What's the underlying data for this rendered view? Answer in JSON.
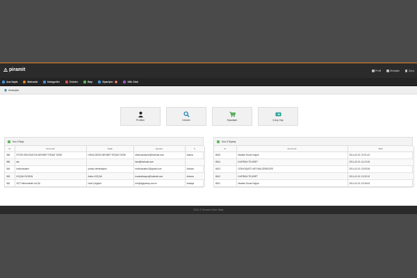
{
  "header": {
    "logo_text": "piramit",
    "right": [
      {
        "label": "Profil",
        "icon": "user-icon"
      },
      {
        "label": "Mesajlar",
        "icon": "mail-icon"
      },
      {
        "label": "Çıkış",
        "icon": "logout-icon"
      }
    ]
  },
  "nav": [
    {
      "label": "Ana Sayfa",
      "icon": "home-icon",
      "color": "#4a90d9"
    },
    {
      "label": "Mahsulat",
      "icon": "orange-icon",
      "color": "#e8892c"
    },
    {
      "label": "Kategoriler",
      "icon": "grid-icon",
      "color": "#4a90d9"
    },
    {
      "label": "Ürünler",
      "icon": "box-icon",
      "color": "#d9534f"
    },
    {
      "label": "Bayi",
      "icon": "dealer-icon",
      "color": "#5cb85c"
    },
    {
      "label": "Siparişler",
      "icon": "cart-icon",
      "color": "#4a90d9",
      "badge": "5"
    },
    {
      "label": "XML Stok",
      "icon": "xml-icon",
      "color": "#9b59b6"
    }
  ],
  "breadcrumb": "Anasayfa",
  "tiles": [
    {
      "label": "Profilim",
      "icon": "user-icon"
    },
    {
      "label": "Ürünler",
      "icon": "search-icon"
    },
    {
      "label": "Siparişler",
      "icon": "cart-icon"
    },
    {
      "label": "Çıkış Yap",
      "icon": "exit-icon"
    }
  ],
  "left_panel": {
    "title": "Son 5 Bayi",
    "columns": [
      "Id",
      "Firma Adı",
      "Yetkili",
      "Eposta",
      "İl"
    ],
    "rows": [
      [
        "366",
        "ETKİN SOKOKAYON MEHMET REŞAT DEDE",
        "HİKKA DEDE MEHMET REŞAT DEDE",
        "etkinsokoksnet@hotmail.com",
        "Adana"
      ],
      [
        "365",
        "afs",
        "",
        "fasd@hotmail.com",
        ""
      ],
      [
        "364",
        "mafa tasarim",
        "yılmaz demirkaşımı",
        "mafa.tasarim2@gmail.com",
        "Ankara"
      ],
      [
        "363",
        "KOÇAK EKSKIN",
        "Adem KOÇAK",
        "kocakeksayın@hotmail.com",
        "Ankara"
      ],
      [
        "362",
        "SGT Mühendislik Ltd.Şti",
        "İzzet Çelgünü",
        "info@sgtpiresp.com.tr",
        "Antalya"
      ]
    ]
  },
  "right_panel": {
    "title": "Son 5 Sipariş",
    "columns": [
      "Id",
      "Firma Adı",
      "Tarih"
    ],
    "rows": [
      [
        "8615",
        "Madem Duvar Kağıdı",
        "2014-12-01 21:01:42"
      ],
      [
        "8614",
        "KAPIRAN TİCARET",
        "2014-12-01 14:13:16"
      ],
      [
        "8613",
        "GÖKKUŞAĞI YAPI MALZEMELERİ",
        "2014-12-01 13:53:26"
      ],
      [
        "8612",
        "KAPIRAN TİCARET",
        "2014-12-01 13:32:10"
      ],
      [
        "8611",
        "Madem Duvar Kağıdı",
        "2014-12-01 13:26:43"
      ]
    ]
  },
  "footer": "2014 © Scontos Stok Takip"
}
